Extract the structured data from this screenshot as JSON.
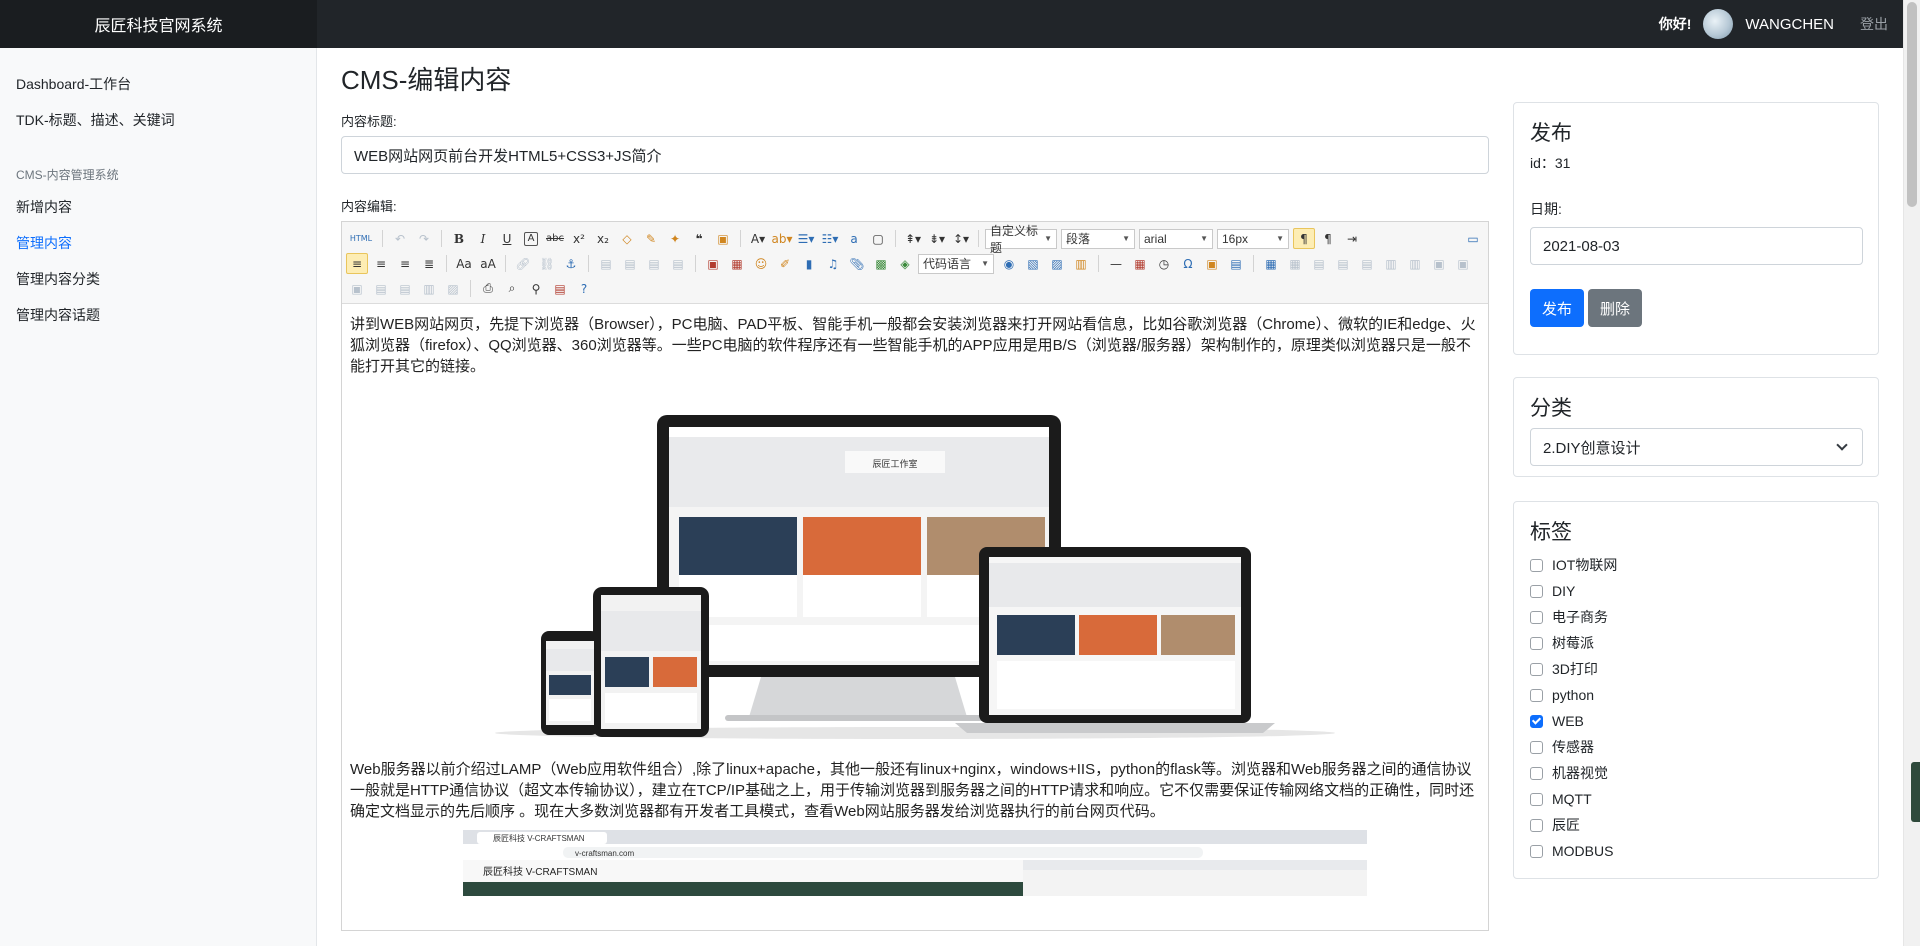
{
  "header": {
    "brand": "辰匠科技官网系统",
    "greeting": "你好!",
    "username": "WANGCHEN",
    "logout": "登出"
  },
  "sidebar": {
    "items": [
      {
        "label": "Dashboard-工作台",
        "active": false
      },
      {
        "label": "TDK-标题、描述、关键词",
        "active": false
      }
    ],
    "section_heading": "CMS-内容管理系统",
    "section_items": [
      {
        "label": "新增内容",
        "active": false
      },
      {
        "label": "管理内容",
        "active": true
      },
      {
        "label": "管理内容分类",
        "active": false
      },
      {
        "label": "管理内容话题",
        "active": false
      }
    ]
  },
  "main": {
    "page_title": "CMS-编辑内容",
    "title_label": "内容标题:",
    "title_value": "WEB网站网页前台开发HTML5+CSS3+JS简介",
    "editor_label": "内容编辑:"
  },
  "editor": {
    "toolbar": {
      "custom_title": "自定义标题",
      "paragraph": "段落",
      "font": "arial",
      "size": "16px",
      "code_lang": "代码语言"
    },
    "paragraph_1": "讲到WEB网站网页，先提下浏览器（Browser），PC电脑、PAD平板、智能手机一般都会安装浏览器来打开网站看信息，比如谷歌浏览器（Chrome）、微软的IE和edge、火狐浏览器（firefox）、QQ浏览器、360浏览器等。一些PC电脑的软件程序还有一些智能手机的APP应用是用B/S（浏览器/服务器）架构制作的，原理类似浏览器只是一般不能打开其它的链接。",
    "paragraph_2": "Web服务器以前介绍过LAMP（Web应用软件组合）,除了linux+apache，其他一般还有linux+nginx，windows+IIS，python的flask等。浏览器和Web服务器之间的通信协议一般就是HTTP通信协议（超文本传输协议），建立在TCP/IP基础之上，用于传输浏览器到服务器之间的HTTP请求和响应。它不仅需要保证传输网络文档的正确性，同时还确定文档显示的先后顺序 。现在大多数浏览器都有开发者工具模式，查看Web网站服务器发给浏览器执行的前台网页代码。",
    "mock_site_title": "辰匠工作室",
    "mock_browser_tab": "辰匠科技 V-CRAFTSMAN",
    "mock_url": "v-craftsman.com",
    "mock_site_brand": "辰匠科技 V-CRAFTSMAN"
  },
  "publish": {
    "heading": "发布",
    "id_line": "id：31",
    "date_label": "日期:",
    "date_value": "2021-08-03",
    "publish_btn": "发布",
    "delete_btn": "删除"
  },
  "category": {
    "heading": "分类",
    "selected": "2.DIY创意设计"
  },
  "tags": {
    "heading": "标签",
    "items": [
      {
        "label": "IOT物联网",
        "checked": false
      },
      {
        "label": "DIY",
        "checked": false
      },
      {
        "label": "电子商务",
        "checked": false
      },
      {
        "label": "树莓派",
        "checked": false
      },
      {
        "label": "3D打印",
        "checked": false
      },
      {
        "label": "python",
        "checked": false
      },
      {
        "label": "WEB",
        "checked": true
      },
      {
        "label": "传感器",
        "checked": false
      },
      {
        "label": "机器视觉",
        "checked": false
      },
      {
        "label": "MQTT",
        "checked": false
      },
      {
        "label": "辰匠",
        "checked": false
      },
      {
        "label": "MODBUS",
        "checked": false
      }
    ]
  },
  "colors": {
    "navbar": "#212529",
    "accent": "#0d6efd",
    "secondary": "#6c757d"
  }
}
